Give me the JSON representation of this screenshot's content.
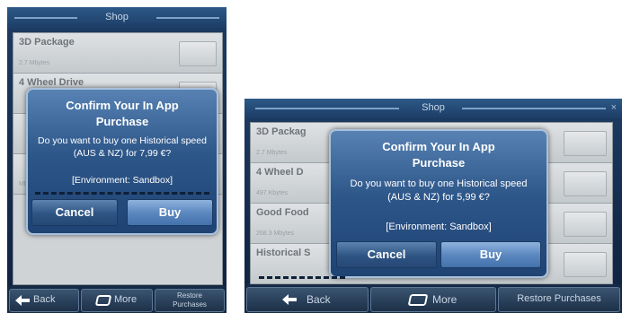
{
  "left": {
    "header_title": "Shop",
    "list_items": [
      {
        "name": "3D Package",
        "size": "2.7 Mbytes"
      },
      {
        "name": "4 Wheel Drive",
        "size": ""
      },
      {
        "name": "",
        "size": ""
      },
      {
        "name": "",
        "size": "Mbytes"
      }
    ],
    "dialog": {
      "title": "Confirm Your In App Purchase",
      "message": "Do you want to buy one Historical speed (AUS & NZ) for 7,99 €?",
      "environment": "[Environment: Sandbox]",
      "cancel_label": "Cancel",
      "buy_label": "Buy"
    },
    "bottom": {
      "back_label": "Back",
      "more_label": "More",
      "restore_label": "Restore Purchases"
    }
  },
  "right": {
    "header_title": "Shop",
    "close_glyph": "×",
    "list_items": [
      {
        "name": "3D Packag",
        "size": "2.7 Mbytes"
      },
      {
        "name": "4 Wheel D",
        "size": "497 Kbytes"
      },
      {
        "name": "Good Food",
        "size": "268.3 Mbytes"
      },
      {
        "name": "Historical S",
        "size": ""
      }
    ],
    "dialog": {
      "title": "Confirm Your In App Purchase",
      "message": "Do you want to buy one Historical speed (AUS & NZ) for 5,99 €?",
      "environment": "[Environment: Sandbox]",
      "cancel_label": "Cancel",
      "buy_label": "Buy"
    },
    "bottom": {
      "back_label": "Back",
      "more_label": "More",
      "restore_label": "Restore Purchases"
    }
  }
}
